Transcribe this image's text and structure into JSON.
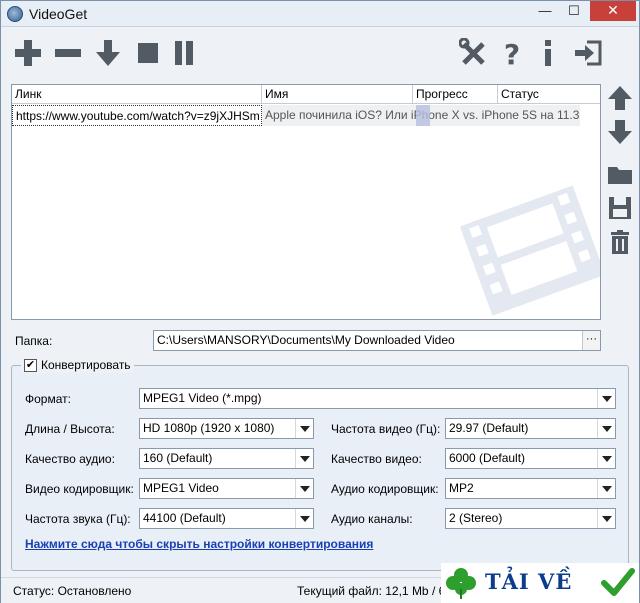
{
  "window": {
    "title": "VideoGet",
    "min_glyph": "—",
    "max_glyph": "☐",
    "close_glyph": "✕"
  },
  "toolbar": {
    "icons": [
      "add-icon",
      "remove-icon",
      "download-icon",
      "stop-icon",
      "pause-icon",
      "settings-icon",
      "help-icon",
      "info-icon",
      "exit-icon"
    ]
  },
  "side_buttons": [
    "move-up-icon",
    "move-down-icon",
    "folder-icon",
    "save-icon",
    "trash-icon"
  ],
  "list": {
    "columns": [
      "Линк",
      "Имя",
      "Прогресс",
      "Статус"
    ],
    "rows": [
      {
        "link": "https://www.youtube.com/watch?v=z9jXJHSm",
        "name": "Apple починила iOS? Или iPhone X vs. iPhone 5S на 11.3"
      }
    ]
  },
  "folder": {
    "label": "Папка:",
    "path": "C:\\Users\\MANSORY\\Documents\\My Downloaded Video",
    "browse": "···"
  },
  "convert": {
    "enabled": true,
    "check_glyph": "✔",
    "label": "Конвертировать",
    "format_label": "Формат:",
    "format_value": "MPEG1 Video (*.mpg)",
    "size_label": "Длина / Высота:",
    "size_value": "HD 1080p (1920 x 1080)",
    "fps_label": "Частота видео (Гц):",
    "fps_value": "29.97 (Default)",
    "audio_quality_label": "Качество аудио:",
    "audio_quality_value": "160 (Default)",
    "video_quality_label": "Качество видео:",
    "video_quality_value": "6000 (Default)",
    "video_codec_label": "Видео кодировщик:",
    "video_codec_value": "MPEG1 Video",
    "audio_codec_label": "Аудио кодировщик:",
    "audio_codec_value": "MP2",
    "sample_rate_label": "Частота звука (Гц):",
    "sample_rate_value": "44100 (Default)",
    "channels_label": "Аудио каналы:",
    "channels_value": "2 (Stereo)",
    "hide_link": "Нажмите сюда чтобы скрыть настройки конвертирования"
  },
  "status": {
    "state": "Статус: Остановлено",
    "current_file": "Текущий файл: 12,1 Mb / 6"
  },
  "watermark_logo": {
    "text": "TẢI VỀ",
    "colors": {
      "text": "#0c3d8c",
      "clover": "#2e9e2e",
      "check": "#2e9e2e"
    }
  },
  "colors": {
    "icon": "#525a63",
    "link": "#1a3fb5",
    "close_button": "#c7413a"
  }
}
